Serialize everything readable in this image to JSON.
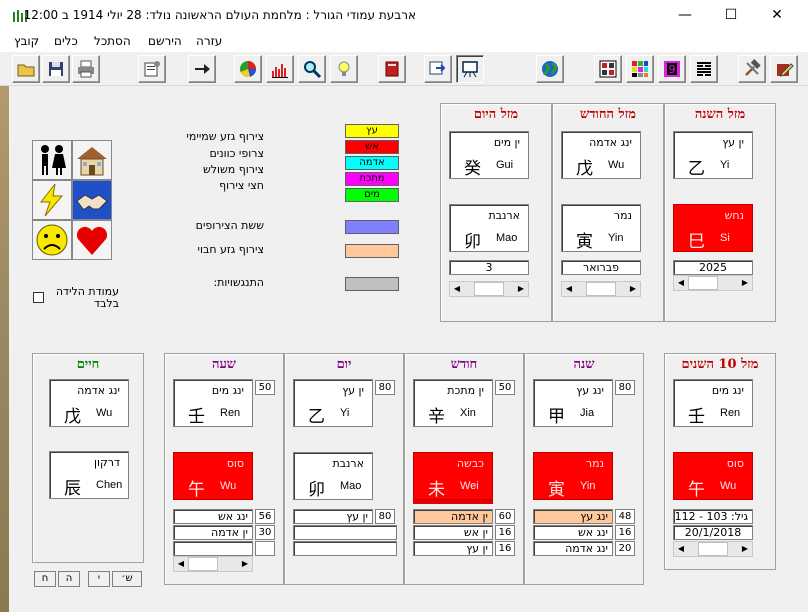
{
  "window": {
    "title": "ארבעת עמודי הגורל : מלחמת העולם הראשונה   נולד: 28 יולי 1914 ב 12:00",
    "minimize": "—",
    "maximize": "☐",
    "close": "✕"
  },
  "menu": [
    "קובץ",
    "כלים",
    "הסתכל",
    "הירשם",
    "עזרה"
  ],
  "legend": {
    "labels": [
      "צירוף גזע שמיימי",
      "צרופי כוונים",
      "צירוף משולש",
      "חצי צירוף"
    ],
    "elements": [
      {
        "label": "עץ",
        "color": "#ffff00"
      },
      {
        "label": "אש",
        "color": "#ff0000"
      },
      {
        "label": "אדמה",
        "color": "#00ffff"
      },
      {
        "label": "מתכת",
        "color": "#ff00ff"
      },
      {
        "label": "מים",
        "color": "#00ff00"
      }
    ],
    "six": {
      "label": "ששת הצירופים",
      "color": "#8080ff"
    },
    "branch": {
      "label": "צירוף גזע חבוי",
      "color": "#ffc89b"
    },
    "clash": {
      "label": "התנגשויות:",
      "color": "#c0c0c0"
    }
  },
  "checkbox": {
    "label_line1": "עמודת הלידה",
    "label_line2": "בלבד"
  },
  "luck": {
    "year": {
      "title": "מזל השנה",
      "stem_heb": "ין עץ",
      "stem_han": "乙",
      "stem_lat": "Yi",
      "branch_heb": "נחש",
      "branch_han": "巳",
      "branch_lat": "Si",
      "value": "2025"
    },
    "month": {
      "title": "מזל החודש",
      "stem_heb": "ינג אדמה",
      "stem_han": "戊",
      "stem_lat": "Wu",
      "branch_heb": "נמר",
      "branch_han": "寅",
      "branch_lat": "Yin",
      "value": "פברואר"
    },
    "day": {
      "title": "מזל היום",
      "stem_heb": "ין מים",
      "stem_han": "癸",
      "stem_lat": "Gui",
      "branch_heb": "ארנבת",
      "branch_han": "卯",
      "branch_lat": "Mao",
      "value": "3"
    }
  },
  "pillars": {
    "life": {
      "title": "חיים",
      "stem_heb": "ינג אדמה",
      "stem_han": "戊",
      "stem_lat": "Wu",
      "branch_heb": "דרקון",
      "branch_han": "辰",
      "branch_lat": "Chen"
    },
    "hour": {
      "title": "שעה",
      "score": "50",
      "stem_heb": "ינג מים",
      "stem_han": "壬",
      "stem_lat": "Ren",
      "branch_heb": "סוס",
      "branch_han": "午",
      "branch_lat": "Wu",
      "rows": [
        {
          "label": "ינג אש",
          "val": "56"
        },
        {
          "label": "ין אדמה",
          "val": "30"
        },
        {
          "label": "",
          "val": ""
        }
      ]
    },
    "day": {
      "title": "יום",
      "score": "80",
      "stem_heb": "ין עץ",
      "stem_han": "乙",
      "stem_lat": "Yi",
      "branch_heb": "ארנבת",
      "branch_han": "卯",
      "branch_lat": "Mao",
      "rows": [
        {
          "label": "ין עץ",
          "val": "80"
        },
        {
          "label": "",
          "val": ""
        },
        {
          "label": "",
          "val": ""
        }
      ]
    },
    "month": {
      "title": "חודש",
      "score": "50",
      "stem_heb": "ין מתכת",
      "stem_han": "辛",
      "stem_lat": "Xin",
      "branch_heb": "כבשה",
      "branch_han": "未",
      "branch_lat": "Wei",
      "rows": [
        {
          "label": "ין אדמה",
          "val": "60"
        },
        {
          "label": "ין אש",
          "val": "16"
        },
        {
          "label": "ין עץ",
          "val": "16"
        }
      ]
    },
    "year": {
      "title": "שנה",
      "score": "80",
      "stem_heb": "ינג עץ",
      "stem_han": "甲",
      "stem_lat": "Jia",
      "branch_heb": "נמר",
      "branch_han": "寅",
      "branch_lat": "Yin",
      "rows": [
        {
          "label": "ינג עץ",
          "val": "48"
        },
        {
          "label": "ינג אש",
          "val": "16"
        },
        {
          "label": "ינג אדמה",
          "val": "20"
        }
      ]
    },
    "decade": {
      "title": "מזל 10 השנים",
      "stem_heb": "ינג מים",
      "stem_han": "壬",
      "stem_lat": "Ren",
      "branch_heb": "סוס",
      "branch_han": "午",
      "branch_lat": "Wu",
      "age": "גיל: 103 - 112",
      "date": "20/1/2018"
    }
  },
  "bottom_tabs": [
    "ש׳",
    "י",
    "ה",
    "ח"
  ]
}
